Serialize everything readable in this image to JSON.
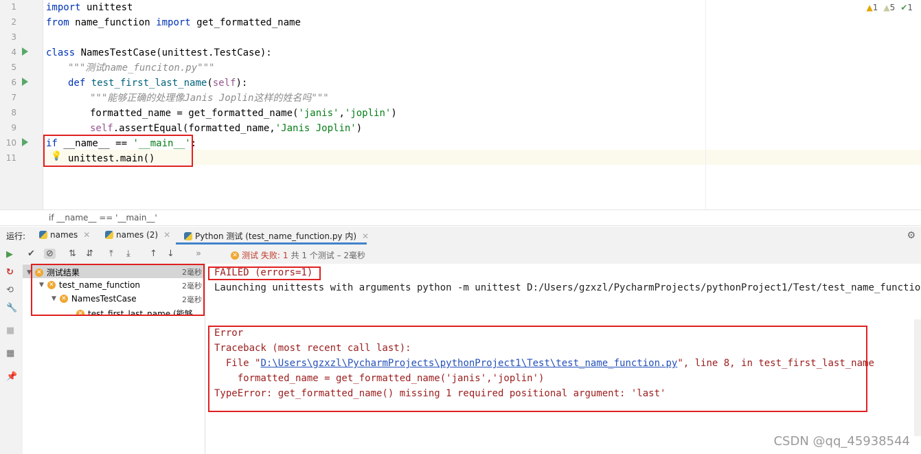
{
  "editor": {
    "line_numbers": [
      "1",
      "2",
      "3",
      "4",
      "5",
      "6",
      "7",
      "8",
      "9",
      "10",
      "11"
    ],
    "inspections": {
      "warn_count": "1",
      "weak_count": "5",
      "ok_count": "1"
    },
    "lines": {
      "l1": {
        "k1": "import",
        "t1": " unittest"
      },
      "l2": {
        "k1": "from",
        "t1": " name_function ",
        "k2": "import",
        "t2": " get_formatted_name"
      },
      "l4": {
        "k1": "class",
        "t1": " NamesTestCase(unittest.TestCase):"
      },
      "l5": {
        "doc": "\"\"\"测试name_funciton.py\"\"\""
      },
      "l6": {
        "k1": "def",
        "fn": " test_first_last_name",
        "p1": "(",
        "self": "self",
        "p2": "):"
      },
      "l7": {
        "doc": "\"\"\"能够正确的处理像Janis Joplin这样的姓名吗\"\"\""
      },
      "l8": {
        "t1": "formatted_name = get_formatted_name(",
        "s1": "'janis'",
        "t2": ",",
        "s2": "'joplin'",
        "t3": ")"
      },
      "l9": {
        "self": "self",
        "t1": ".assertEqual(formatted_name,",
        "s1": "'Janis Joplin'",
        "t2": ")"
      },
      "l10": {
        "k1": "if",
        "t1": " __name__ == ",
        "s1": "'__main__'",
        "t2": ":"
      },
      "l11": {
        "t1": "unittest.main()"
      }
    },
    "breadcrumb": "if __name__ == '__main__'"
  },
  "run": {
    "label": "运行:",
    "tabs": [
      "names",
      "names (2)",
      "Python 测试 (test_name_function.py 内)"
    ]
  },
  "test_status": {
    "prefix": "测试 失败: ",
    "count": "1",
    "suffix": "共 1 个测试 – 2毫秒"
  },
  "tree": [
    {
      "label": "测试结果",
      "time": "2毫秒"
    },
    {
      "label": "test_name_function",
      "time": "2毫秒"
    },
    {
      "label": "NamesTestCase",
      "time": "2毫秒"
    },
    {
      "label": "test_first_last_name (能够",
      "time": ""
    }
  ],
  "console": {
    "failed": "FAILED (errors=1)",
    "launching": "Launching unittests with arguments python -m unittest D:/Users/gzxzl/PycharmProjects/pythonProject1/Test/test_name_function.py i",
    "error_title": "Error",
    "traceback": "Traceback (most recent call last):",
    "file_prefix": "  File \"",
    "file_path": "D:\\Users\\gzxzl\\PycharmProjects\\pythonProject1\\Test\\test_name_function.py",
    "file_suffix": "\", line 8, in test_first_last_name",
    "code_line": "    formatted_name = get_formatted_name('janis','joplin')",
    "type_error": "TypeError: get_formatted_name() missing 1 required positional argument: 'last'"
  },
  "watermark": "CSDN @qq_45938544",
  "colors": {
    "highlight_box": "#e02020",
    "keyword": "#0033b3",
    "string": "#067d17",
    "run_green": "#59a869"
  },
  "icons": [
    "run-gutter-icon",
    "lightbulb-icon",
    "python-icon",
    "gear-icon",
    "rerun-icon",
    "check-icon",
    "stop-icon",
    "sort-icon",
    "expand-icon",
    "collapse-icon",
    "up-arrow-icon",
    "down-arrow-icon",
    "test-error-icon"
  ]
}
